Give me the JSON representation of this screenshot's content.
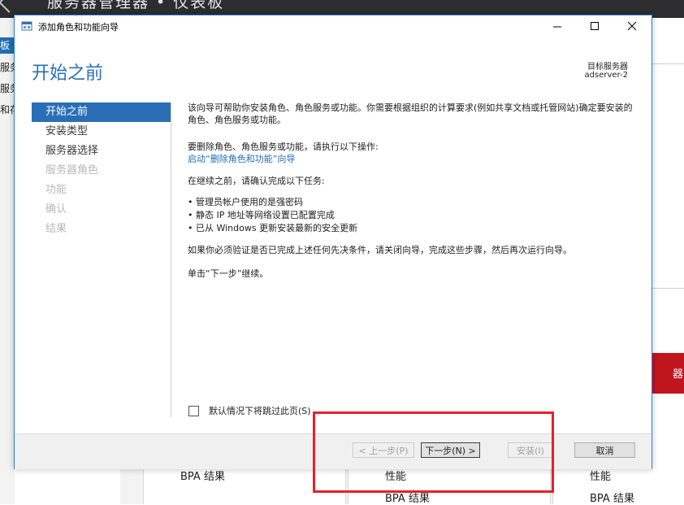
{
  "background": {
    "title": "服务器管理器 • 仪表板",
    "left_items": [
      "板",
      "服务",
      "服务",
      "和存"
    ],
    "red_tile_text": "器",
    "bottom": {
      "col1": [
        "BPA 结果"
      ],
      "col2": [
        "性能",
        "BPA 结果"
      ],
      "col3": [
        "性能",
        "BPA 结果"
      ]
    }
  },
  "dialog": {
    "window_title": "添加角色和功能向导",
    "page_title": "开始之前",
    "target_server_label": "目标服务器",
    "target_server_value": "adserver-2",
    "nav": [
      {
        "label": "开始之前",
        "state": "active"
      },
      {
        "label": "安装类型",
        "state": "enabled"
      },
      {
        "label": "服务器选择",
        "state": "enabled"
      },
      {
        "label": "服务器角色",
        "state": "disabled"
      },
      {
        "label": "功能",
        "state": "disabled"
      },
      {
        "label": "确认",
        "state": "disabled"
      },
      {
        "label": "结果",
        "state": "disabled"
      }
    ],
    "content": {
      "intro": "该向导可帮助你安装角色、角色服务或功能。你需要根据组织的计算要求(例如共享文档或托管网站)确定要安装的角色、角色服务或功能。",
      "remove_heading": "要删除角色、角色服务或功能，请执行以下操作:",
      "remove_link": "启动“删除角色和功能”向导",
      "before_continue": "在继续之前，请确认完成以下任务:",
      "tasks": [
        "管理员帐户使用的是强密码",
        "静态 IP 地址等网络设置已配置完成",
        "已从 Windows 更新安装最新的安全更新"
      ],
      "verify_note": "如果你必须验证是否已完成上述任何先决条件，请关闭向导，完成这些步骤，然后再次运行向导。",
      "click_next": "单击“下一步”继续。"
    },
    "skip_checkbox_label": "默认情况下将跳过此页(S)",
    "skip_checked": false,
    "buttons": {
      "previous": "< 上一步(P)",
      "next": "下一步(N) >",
      "install": "安装(I)",
      "cancel": "取消"
    }
  },
  "colors": {
    "accent": "#2a6fb6",
    "highlight": "#e8202a",
    "link": "#1f6eb4"
  }
}
